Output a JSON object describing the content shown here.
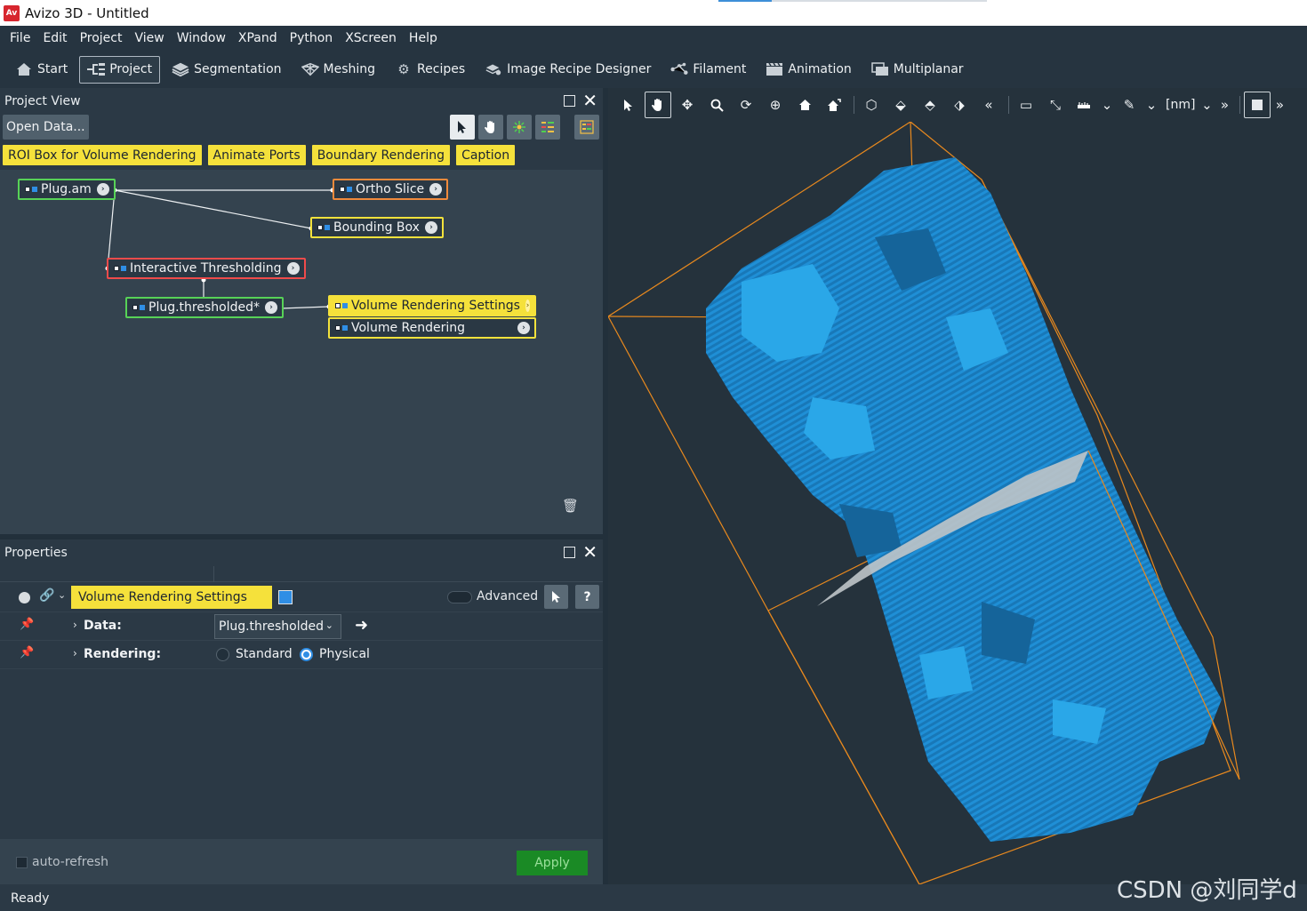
{
  "window": {
    "title": "Avizo 3D - Untitled",
    "logo_text": "Av"
  },
  "menu": [
    "File",
    "Edit",
    "Project",
    "View",
    "Window",
    "XPand",
    "Python",
    "XScreen",
    "Help"
  ],
  "workrooms": [
    {
      "label": "Start",
      "icon": "home-icon"
    },
    {
      "label": "Project",
      "icon": "project-tree-icon",
      "active": true
    },
    {
      "label": "Segmentation",
      "icon": "segmentation-layers-icon"
    },
    {
      "label": "Meshing",
      "icon": "mesh-icon"
    },
    {
      "label": "Recipes",
      "icon": "recipes-gears-icon"
    },
    {
      "label": "Image Recipe Designer",
      "icon": "recipe-designer-icon"
    },
    {
      "label": "Filament",
      "icon": "filament-icon"
    },
    {
      "label": "Animation",
      "icon": "animation-clapper-icon"
    },
    {
      "label": "Multiplanar",
      "icon": "multiplanar-icon"
    }
  ],
  "project_view": {
    "title": "Project View",
    "open_data": "Open Data...",
    "quick_buttons": [
      "ROI Box for Volume Rendering",
      "Animate Ports",
      "Boundary Rendering",
      "Caption"
    ],
    "nodes": {
      "plug_am": "Plug.am",
      "ortho_slice": "Ortho Slice",
      "bounding_box": "Bounding Box",
      "interactive_thresholding": "Interactive Thresholding",
      "plug_thresholded": "Plug.thresholded*",
      "volume_rendering_settings": "Volume Rendering Settings",
      "volume_rendering": "Volume Rendering"
    }
  },
  "properties": {
    "title": "Properties",
    "module_name": "Volume Rendering Settings",
    "advanced_label": "Advanced",
    "help_label": "?",
    "rows": {
      "data_label": "Data:",
      "data_value": "Plug.thresholded",
      "rendering_label": "Rendering:",
      "rendering_options": [
        "Standard",
        "Physical"
      ],
      "rendering_selected": "Physical"
    },
    "auto_refresh_label": "auto-refresh",
    "auto_refresh_checked": false,
    "apply_label": "Apply"
  },
  "viewer": {
    "units_label": "[nm]",
    "more_label": "»"
  },
  "status": {
    "text": "Ready"
  },
  "watermark": "CSDN @刘同学d",
  "colors": {
    "accent_yellow": "#f5e13b",
    "data_green": "#57d257",
    "compute_red": "#ef4b4b",
    "volume_blue": "#1f8fd6",
    "bbox_orange": "#e8891e",
    "apply_green": "#1a8a25"
  }
}
